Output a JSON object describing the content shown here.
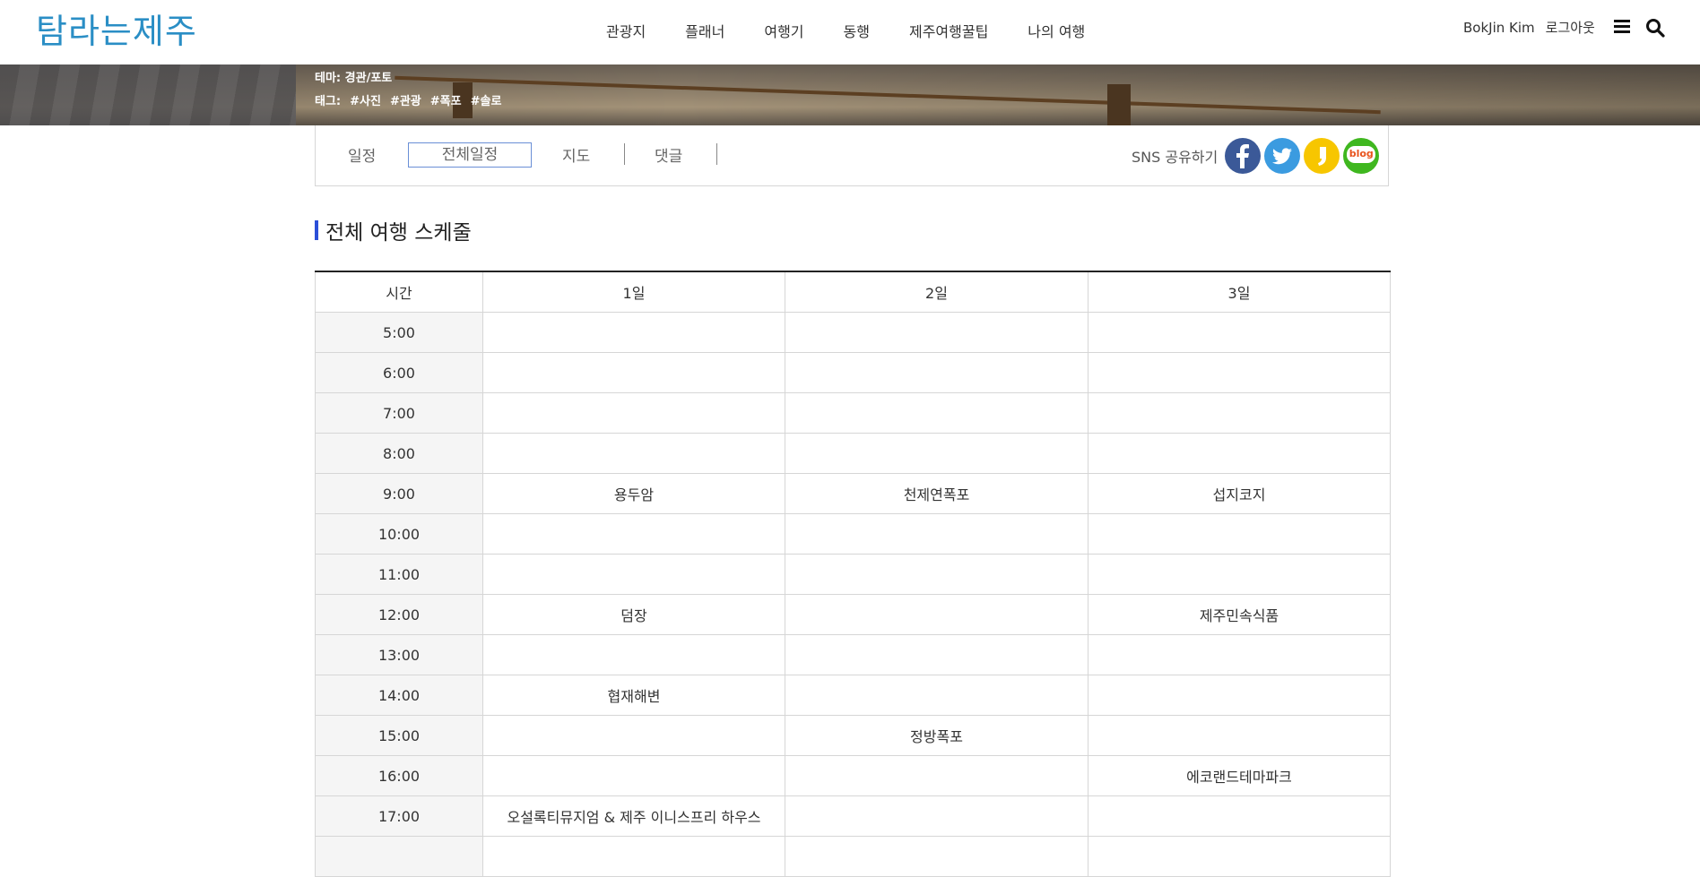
{
  "header": {
    "logo": "탐라는제주",
    "nav": [
      "관광지",
      "플래너",
      "여행기",
      "동행",
      "제주여행꿀팁",
      "나의 여행"
    ],
    "user_name": "BokJin Kim",
    "logout": "로그아웃",
    "menu_icon": "hamburger-menu-icon",
    "search_icon": "search-icon"
  },
  "banner": {
    "theme": "테마: 경관/포토",
    "tag_label": "태그:",
    "tags": [
      "#사진",
      "#관광",
      "#폭포",
      "#솔로"
    ]
  },
  "tabs": {
    "items": [
      "일정",
      "전체일정",
      "지도",
      "댓글"
    ],
    "active": "전체일정",
    "sns_label": "SNS 공유하기",
    "sns_icons": [
      "facebook-icon",
      "twitter-icon",
      "kakaostory-icon",
      "naver-blog-icon"
    ],
    "blog_text": "blog",
    "colors": {
      "facebook": "#3b5998",
      "twitter": "#3b9be0",
      "kakao": "#f7c600",
      "blog": "#3fb71f"
    }
  },
  "section": {
    "title": "전체 여행 스케줄",
    "accent": "#2b4fd8"
  },
  "schedule": {
    "headers": [
      "시간",
      "1일",
      "2일",
      "3일"
    ],
    "rows": [
      {
        "time": "5:00",
        "d1": "",
        "d2": "",
        "d3": ""
      },
      {
        "time": "6:00",
        "d1": "",
        "d2": "",
        "d3": ""
      },
      {
        "time": "7:00",
        "d1": "",
        "d2": "",
        "d3": ""
      },
      {
        "time": "8:00",
        "d1": "",
        "d2": "",
        "d3": ""
      },
      {
        "time": "9:00",
        "d1": "용두암",
        "d2": "천제연폭포",
        "d3": "섭지코지"
      },
      {
        "time": "10:00",
        "d1": "",
        "d2": "",
        "d3": ""
      },
      {
        "time": "11:00",
        "d1": "",
        "d2": "",
        "d3": ""
      },
      {
        "time": "12:00",
        "d1": "덤장",
        "d2": "",
        "d3": "제주민속식품"
      },
      {
        "time": "13:00",
        "d1": "",
        "d2": "",
        "d3": ""
      },
      {
        "time": "14:00",
        "d1": "협재해변",
        "d2": "",
        "d3": ""
      },
      {
        "time": "15:00",
        "d1": "",
        "d2": "정방폭포",
        "d3": ""
      },
      {
        "time": "16:00",
        "d1": "",
        "d2": "",
        "d3": "에코랜드테마파크"
      },
      {
        "time": "17:00",
        "d1": "오설록티뮤지엄 & 제주 이니스프리 하우스",
        "d2": "",
        "d3": ""
      },
      {
        "time": "",
        "d1": "",
        "d2": "",
        "d3": ""
      }
    ]
  }
}
